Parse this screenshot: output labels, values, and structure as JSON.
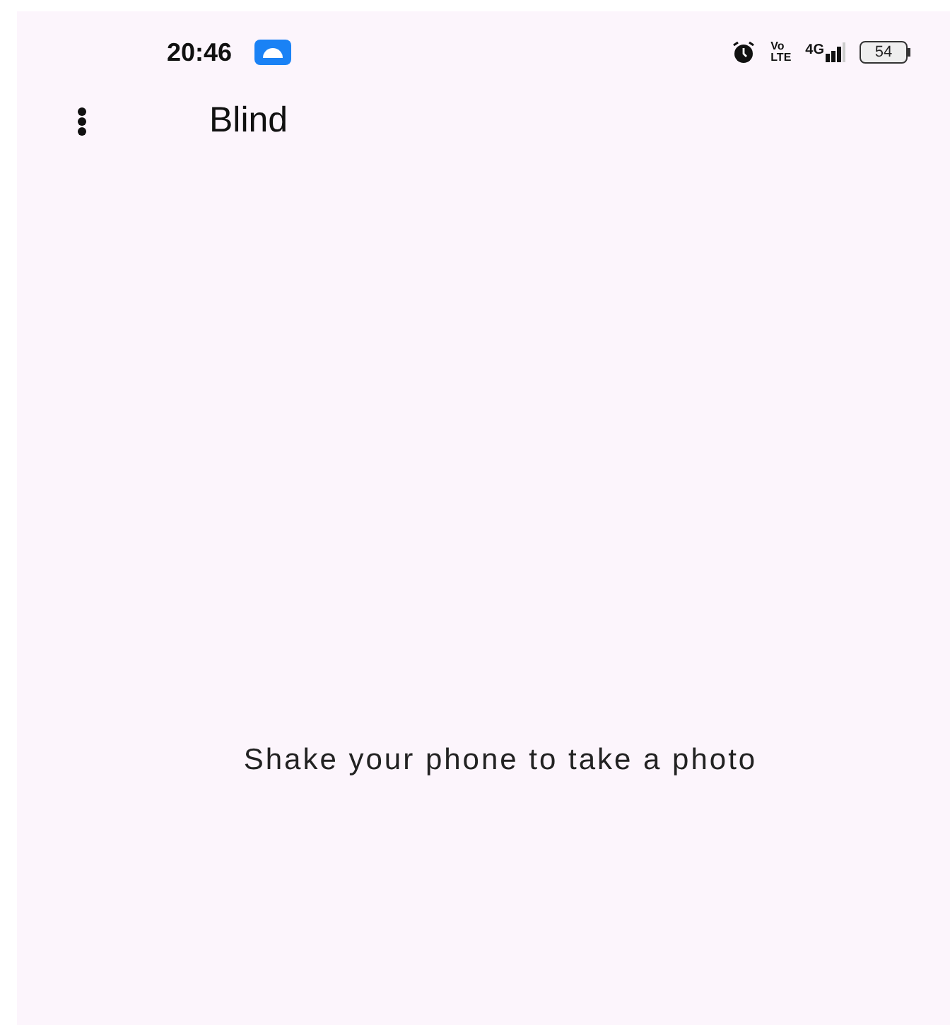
{
  "status_bar": {
    "time": "20:46",
    "volte_top": "Vo",
    "volte_bottom": "LTE",
    "network": "4G",
    "battery": "54"
  },
  "app_bar": {
    "title": "Blind"
  },
  "message": "Shake your phone to take a photo"
}
